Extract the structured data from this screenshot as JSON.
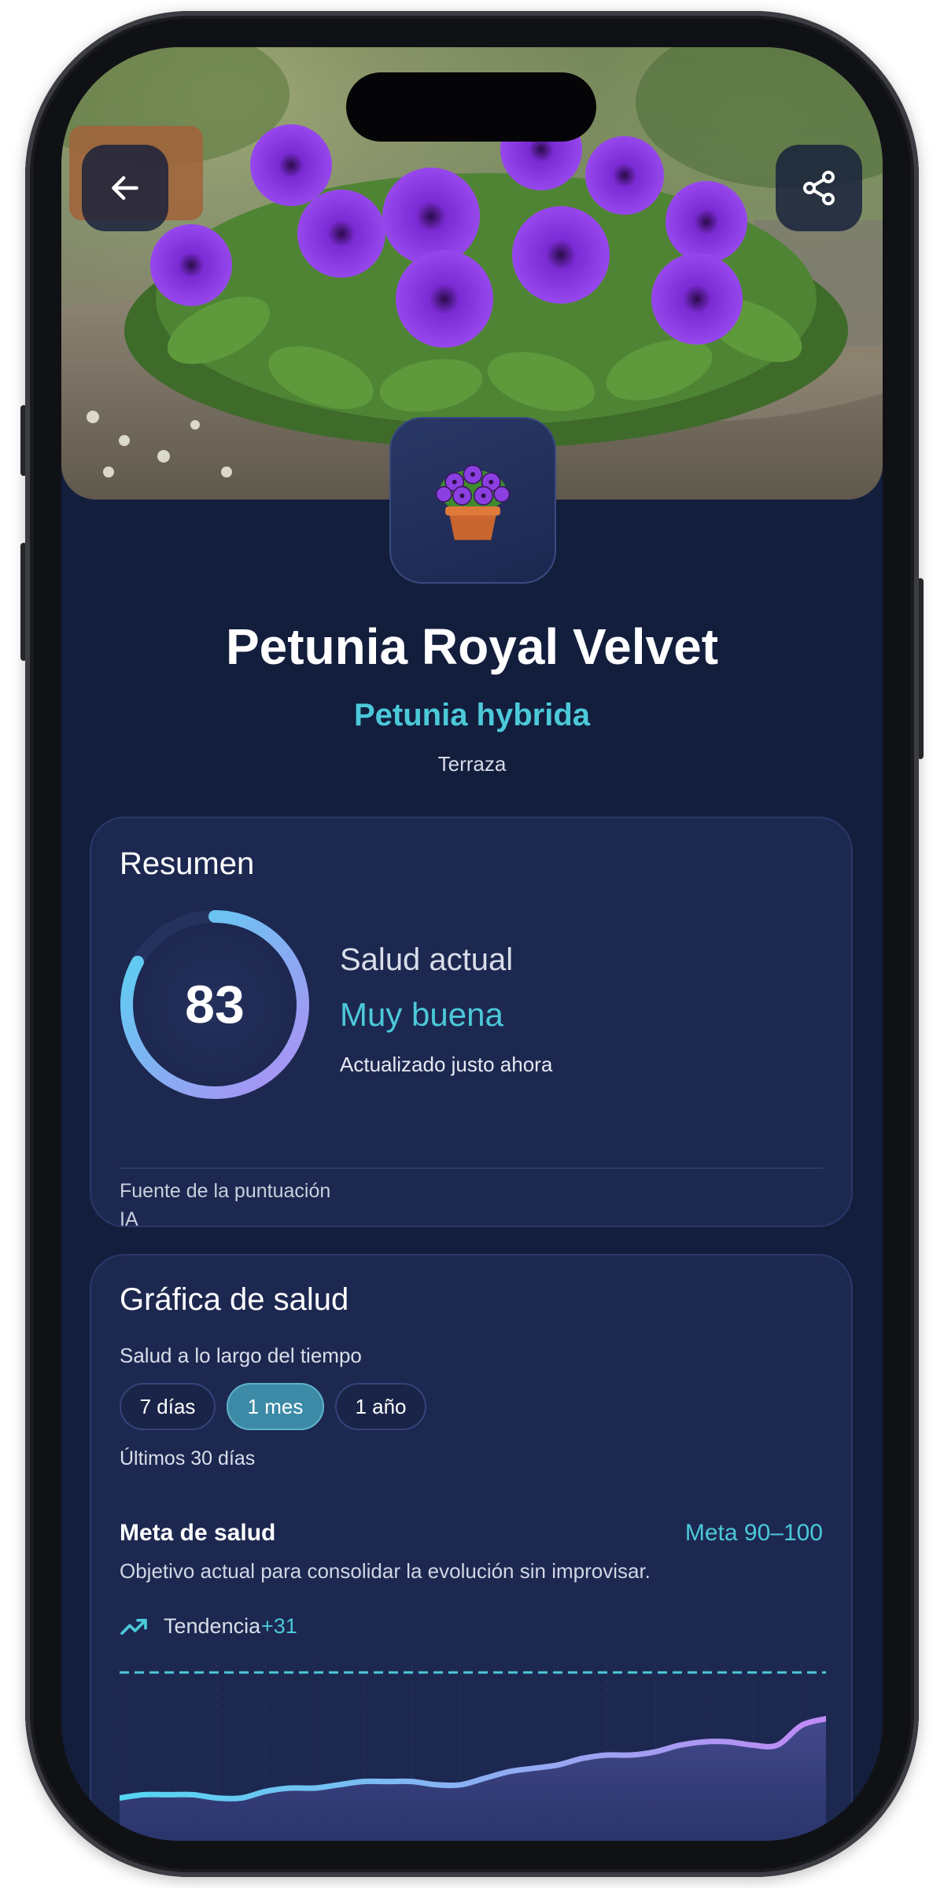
{
  "header": {
    "back_icon": "arrow-left-icon",
    "share_icon": "share-icon",
    "plant_icon": "potted-plant-icon"
  },
  "plant": {
    "name": "Petunia Royal Velvet",
    "scientific_name": "Petunia hybrida",
    "location": "Terraza"
  },
  "summary": {
    "title": "Resumen",
    "score": "83",
    "score_fraction": 0.83,
    "health_label": "Salud actual",
    "health_status": "Muy buena",
    "updated": "Actualizado justo ahora",
    "source_label": "Fuente de la puntuación",
    "source_value": "IA"
  },
  "health_chart": {
    "title": "Gráfica de salud",
    "subtitle": "Salud a lo largo del tiempo",
    "ranges": [
      "7 días",
      "1 mes",
      "1 año"
    ],
    "selected_range": "1 mes",
    "range_caption": "Últimos 30 días",
    "goal_title": "Meta de salud",
    "goal_range": "Meta 90–100",
    "goal_description": "Objetivo actual para consolidar la evolución sin improvisar.",
    "trend_label": "Tendencia",
    "trend_value": "+31",
    "trend_icon": "trending-up-icon"
  },
  "colors": {
    "background": "#131e3d",
    "card": "#1d2850",
    "accent": "#4cc9d9",
    "ring_start": "#b08cf4",
    "ring_end": "#54d6f2"
  },
  "chart_data": {
    "type": "area",
    "x": [
      1,
      2,
      3,
      4,
      5,
      6,
      7,
      8,
      9,
      10,
      11,
      12,
      13,
      14,
      15,
      16,
      17,
      18,
      19,
      20,
      21,
      22,
      23,
      24,
      25,
      26,
      27,
      28,
      29,
      30
    ],
    "series": [
      {
        "values": [
          52,
          53,
          53,
          53,
          52,
          52,
          54,
          55,
          55,
          56,
          57,
          57,
          57,
          56,
          56,
          58,
          60,
          61,
          62,
          64,
          65,
          65,
          66,
          68,
          69,
          69,
          68,
          68,
          74,
          76
        ]
      }
    ],
    "goal_line": 90,
    "ylim": [
      0,
      100
    ]
  }
}
